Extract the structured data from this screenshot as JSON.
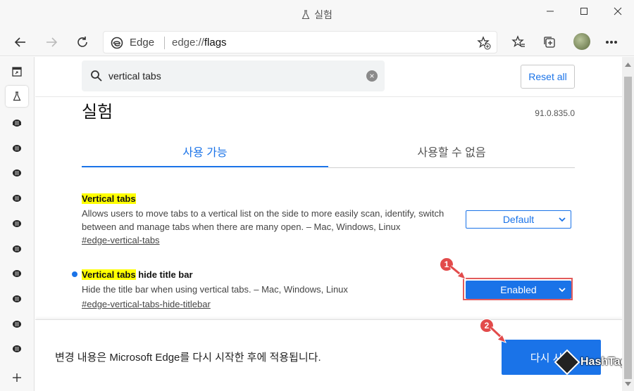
{
  "window": {
    "title": "실험"
  },
  "toolbar": {
    "address_brand": "Edge",
    "address_url_prefix": "edge://",
    "address_url_path": "flags"
  },
  "search": {
    "value": "vertical tabs",
    "clear_label": "×"
  },
  "header": {
    "reset_label": "Reset all"
  },
  "page": {
    "title": "실험",
    "version": "91.0.835.0"
  },
  "tabs": [
    {
      "label": "사용 가능",
      "active": true
    },
    {
      "label": "사용할 수 없음",
      "active": false
    }
  ],
  "flags": [
    {
      "title_highlight": "Vertical tabs",
      "title_rest": "",
      "description": "Allows users to move tabs to a vertical list on the side to more easily scan, identify, switch between and manage tabs when there are many open. – Mac, Windows, Linux",
      "link": "#edge-vertical-tabs",
      "selected": "Default",
      "modified": false
    },
    {
      "title_highlight": "Vertical tabs",
      "title_rest": " hide title bar",
      "description": "Hide the title bar when using vertical tabs. – Mac, Windows, Linux",
      "link": "#edge-vertical-tabs-hide-titlebar",
      "selected": "Enabled",
      "modified": true
    }
  ],
  "annotations": {
    "badge1": "1",
    "badge2": "2"
  },
  "footer": {
    "message": "변경 내용은 Microsoft Edge를 다시 시작한 후에 적용됩니다.",
    "restart_label": "다시 시작"
  },
  "watermark": {
    "text": "HashTag"
  },
  "colors": {
    "accent": "#1a73e8",
    "highlight": "#ffff00",
    "annotation": "#e24b4b"
  }
}
